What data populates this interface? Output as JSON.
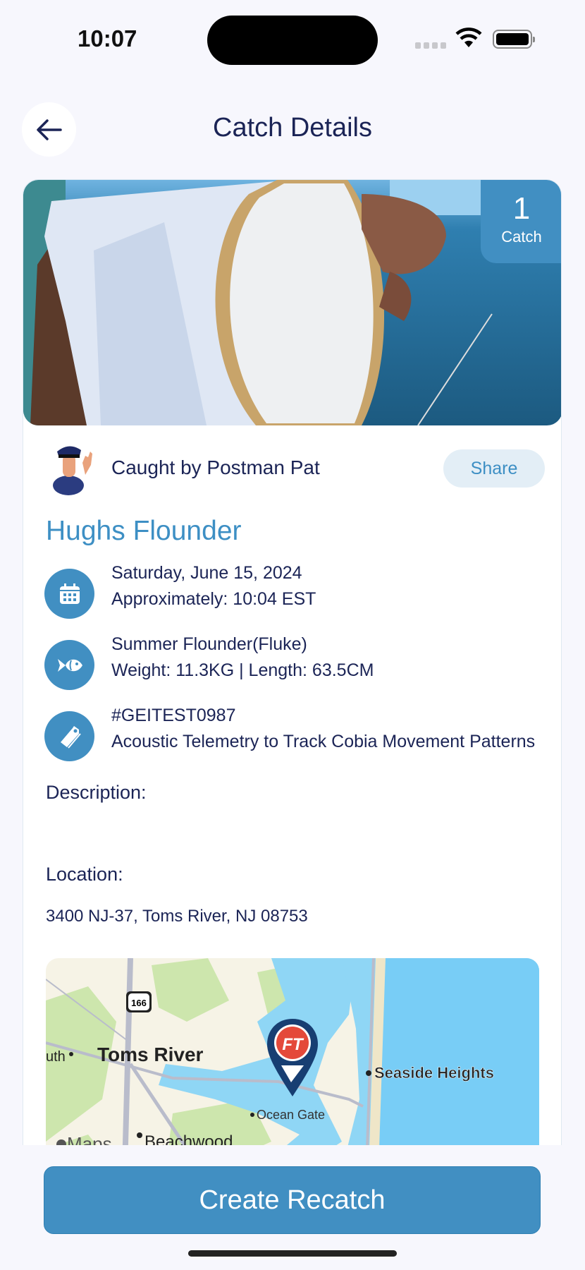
{
  "status_bar": {
    "time": "10:07"
  },
  "header": {
    "title": "Catch Details"
  },
  "card": {
    "catch_count": "1",
    "catch_count_label": "Catch",
    "caught_by": "Caught by Postman Pat",
    "share_label": "Share",
    "catch_name": "Hughs Flounder",
    "details": [
      {
        "icon": "calendar-icon",
        "line1": "Saturday, June 15, 2024",
        "line2": "Approximately: 10:04 EST"
      },
      {
        "icon": "fish-icon",
        "line1": "Summer Flounder(Fluke)",
        "line2": "Weight: 11.3KG | Length: 63.5CM"
      },
      {
        "icon": "tag-icon",
        "line1": "#GEITEST0987",
        "line2": "Acoustic Telemetry to Track Cobia Movement Patterns"
      }
    ],
    "description_label": "Description:",
    "location_label": "Location:",
    "address": "3400 NJ-37, Toms River, NJ 08753",
    "map": {
      "labels": {
        "city": "Toms River",
        "partial": "uth",
        "route": "166",
        "seaside": "Seaside Heights",
        "ocean_gate": "Ocean Gate",
        "beachwood": "Beachwood",
        "maps_logo": "Maps",
        "pin_logo": "FT"
      }
    }
  },
  "footer": {
    "recatch_label": "Create Recatch"
  },
  "colors": {
    "accent": "#418fc2",
    "text": "#1b2456",
    "background": "#f7f7fd"
  }
}
